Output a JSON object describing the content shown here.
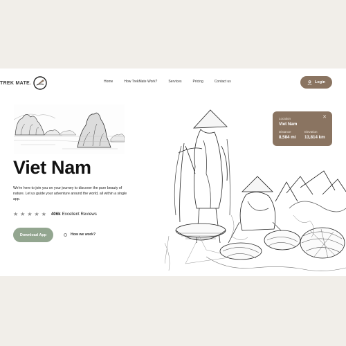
{
  "brand": {
    "name": "TREK MATE",
    "dot": "."
  },
  "nav": {
    "items": [
      "Home",
      "How TrekMate Work?",
      "Services",
      "Pricing",
      "Contact us"
    ]
  },
  "login": {
    "label": "Login"
  },
  "hero": {
    "title": "Viet Nam",
    "description": "We're here to join you on your journey to discover the pure beauty of nature. Let us guide your adventure around the world, all within a single app.",
    "rating": {
      "stars": 5,
      "count": "406k",
      "label": "Excellent Reviews"
    },
    "download_label": "Download App",
    "how_label": "How we work?"
  },
  "info_card": {
    "location_label": "Location",
    "location_value": "Viet Nam",
    "distance_label": "Distance",
    "distance_value": "8,584 mi",
    "elevation_label": "Elevation",
    "elevation_value": "13,814 km"
  },
  "colors": {
    "brand": "#8a7461",
    "accent_green": "#93a690",
    "page_bg": "#f1eee9"
  },
  "icons": [
    "compass-logo-icon",
    "user-icon",
    "star-icon",
    "close-icon"
  ]
}
